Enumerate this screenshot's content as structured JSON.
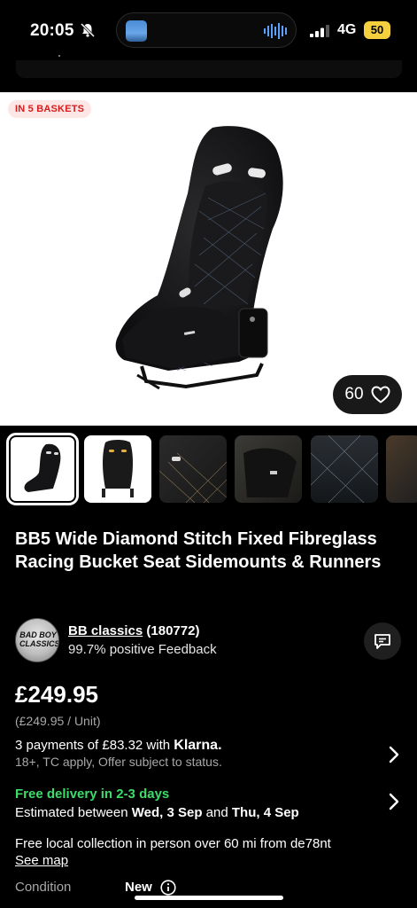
{
  "status_bar": {
    "time": "20:05",
    "network": "4G",
    "battery": "50"
  },
  "listing": {
    "basket_badge": "IN 5 BASKETS",
    "watch_count": "60",
    "title": "BB5 Wide Diamond Stitch Fixed Fibreglass Racing Bucket Seat Sidemounts & Runners",
    "thumbnails_count": 6
  },
  "seller": {
    "name": "BB classics",
    "score": "(180772)",
    "feedback": "99.7% positive Feedback",
    "avatar_text": "BAD BOY CLASSICS"
  },
  "price": {
    "amount": "£249.95",
    "unit": "(£249.95 / Unit)"
  },
  "klarna": {
    "text": "3 payments of £83.32 with",
    "brand": "Klarna.",
    "sub": "18+, TC apply, Offer subject to status."
  },
  "delivery": {
    "headline": "Free delivery in 2-3 days",
    "estimate_prefix": "Estimated between ",
    "date_from": "Wed, 3 Sep",
    "estimate_mid": " and ",
    "date_to": "Thu, 4 Sep"
  },
  "collection": {
    "text": "Free local collection in person over 60 mi from de78nt",
    "see_map": "See map"
  },
  "condition": {
    "label": "Condition",
    "value": "New"
  },
  "colors": {
    "background": "#000000",
    "badge_text": "#d61c1c",
    "badge_bg": "#fde6e6",
    "delivery_green": "#3ddc6a",
    "battery": "#f4d03f"
  }
}
